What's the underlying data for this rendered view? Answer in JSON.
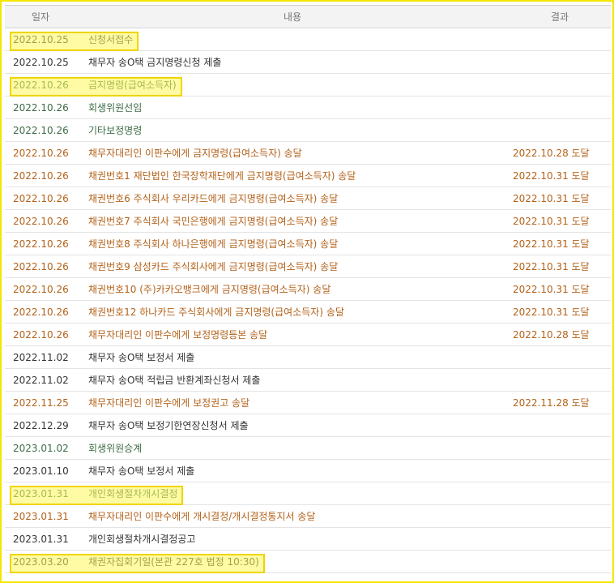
{
  "header": {
    "date": "일자",
    "content": "내용",
    "result": "결과"
  },
  "rows": [
    {
      "date": "2022.10.25",
      "content": "신청서접수",
      "result": "",
      "color": "black",
      "highlight": true
    },
    {
      "date": "2022.10.25",
      "content": "채무자 송O택 금지명령신청 제출",
      "result": "",
      "color": "black",
      "highlight": false
    },
    {
      "date": "2022.10.26",
      "content": "금지명령(급여소득자)",
      "result": "",
      "color": "green",
      "highlight": true
    },
    {
      "date": "2022.10.26",
      "content": "회생위원선임",
      "result": "",
      "color": "green",
      "highlight": false
    },
    {
      "date": "2022.10.26",
      "content": "기타보정명령",
      "result": "",
      "color": "green",
      "highlight": false
    },
    {
      "date": "2022.10.26",
      "content": "채무자대리인 이판수에게 금지명령(급여소득자) 송달",
      "result": "2022.10.28 도달",
      "color": "orange",
      "highlight": false
    },
    {
      "date": "2022.10.26",
      "content": "채권번호1 재단법인 한국장학재단에게 금지명령(급여소득자) 송달",
      "result": "2022.10.31 도달",
      "color": "orange",
      "highlight": false
    },
    {
      "date": "2022.10.26",
      "content": "채권번호6 주식회사 우리카드에게 금지명령(급여소득자) 송달",
      "result": "2022.10.31 도달",
      "color": "orange",
      "highlight": false
    },
    {
      "date": "2022.10.26",
      "content": "채권번호7 주식회사 국민은행에게 금지명령(급여소득자) 송달",
      "result": "2022.10.31 도달",
      "color": "orange",
      "highlight": false
    },
    {
      "date": "2022.10.26",
      "content": "채권번호8 주식회사 하나은행에게 금지명령(급여소득자) 송달",
      "result": "2022.10.31 도달",
      "color": "orange",
      "highlight": false
    },
    {
      "date": "2022.10.26",
      "content": "채권번호9 삼성카드 주식회사에게 금지명령(급여소득자) 송달",
      "result": "2022.10.31 도달",
      "color": "orange",
      "highlight": false
    },
    {
      "date": "2022.10.26",
      "content": "채권번호10 (주)카카오뱅크에게 금지명령(급여소득자) 송달",
      "result": "2022.10.31 도달",
      "color": "orange",
      "highlight": false
    },
    {
      "date": "2022.10.26",
      "content": "채권번호12 하나카드 주식회사에게 금지명령(급여소득자) 송달",
      "result": "2022.10.31 도달",
      "color": "orange",
      "highlight": false
    },
    {
      "date": "2022.10.26",
      "content": "채무자대리인 이판수에게 보정명령등본 송달",
      "result": "2022.10.28 도달",
      "color": "orange",
      "highlight": false
    },
    {
      "date": "2022.11.02",
      "content": "채무자 송O택 보정서 제출",
      "result": "",
      "color": "black",
      "highlight": false
    },
    {
      "date": "2022.11.02",
      "content": "채무자 송O택 적립금 반환계좌신청서 제출",
      "result": "",
      "color": "black",
      "highlight": false
    },
    {
      "date": "2022.11.25",
      "content": "채무자대리인 이판수에게 보정권고 송달",
      "result": "2022.11.28 도달",
      "color": "orange",
      "highlight": false
    },
    {
      "date": "2022.12.29",
      "content": "채무자 송O택 보정기한연장신청서 제출",
      "result": "",
      "color": "black",
      "highlight": false
    },
    {
      "date": "2023.01.02",
      "content": "회생위원승계",
      "result": "",
      "color": "green",
      "highlight": false
    },
    {
      "date": "2023.01.10",
      "content": "채무자 송O택 보정서 제출",
      "result": "",
      "color": "black",
      "highlight": false
    },
    {
      "date": "2023.01.31",
      "content": "개인회생절차개시결정",
      "result": "",
      "color": "green",
      "highlight": true
    },
    {
      "date": "2023.01.31",
      "content": "채무자대리인 이판수에게 개시결정/개시결정통지서 송달",
      "result": "",
      "color": "orange",
      "highlight": false
    },
    {
      "date": "2023.01.31",
      "content": "개인회생절차개시결정공고",
      "result": "",
      "color": "black",
      "highlight": false
    },
    {
      "date": "2023.03.20",
      "content": "채권자집회기일(본관 227호 법정 10:30)",
      "result": "",
      "color": "black",
      "highlight": true
    }
  ]
}
